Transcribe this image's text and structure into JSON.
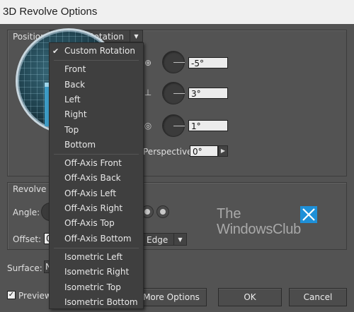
{
  "window": {
    "title": "3D Revolve Options"
  },
  "position": {
    "label": "Position:",
    "selected": "Custom Rotation",
    "x_rotation": "-5°",
    "y_rotation": "3°",
    "z_rotation": "1°",
    "perspective_label": "Perspective:",
    "perspective_value": "0°"
  },
  "menu": {
    "groups": [
      [
        "Custom Rotation"
      ],
      [
        "Front",
        "Back",
        "Left",
        "Right",
        "Top",
        "Bottom"
      ],
      [
        "Off-Axis Front",
        "Off-Axis Back",
        "Off-Axis Left",
        "Off-Axis Right",
        "Off-Axis Top",
        "Off-Axis Bottom"
      ],
      [
        "Isometric Left",
        "Isometric Right",
        "Isometric Top",
        "Isometric Bottom"
      ]
    ],
    "checked": "Custom Rotation"
  },
  "revolve": {
    "group_label": "Revolve",
    "angle_label": "Angle:",
    "offset_label": "Offset:",
    "offset_value": "0",
    "offset_from": "Edge"
  },
  "surface": {
    "label": "Surface:",
    "value": "N"
  },
  "footer": {
    "preview_label": "Preview",
    "preview_checked": true,
    "more_options": "More Options",
    "ok": "OK",
    "cancel": "Cancel"
  },
  "watermark": {
    "line1": "The",
    "line2": "WindowsClub"
  },
  "colors": {
    "dialog_bg": "#535353",
    "menu_bg": "#3f3f3f",
    "logo_blue": "#1e90d8"
  }
}
